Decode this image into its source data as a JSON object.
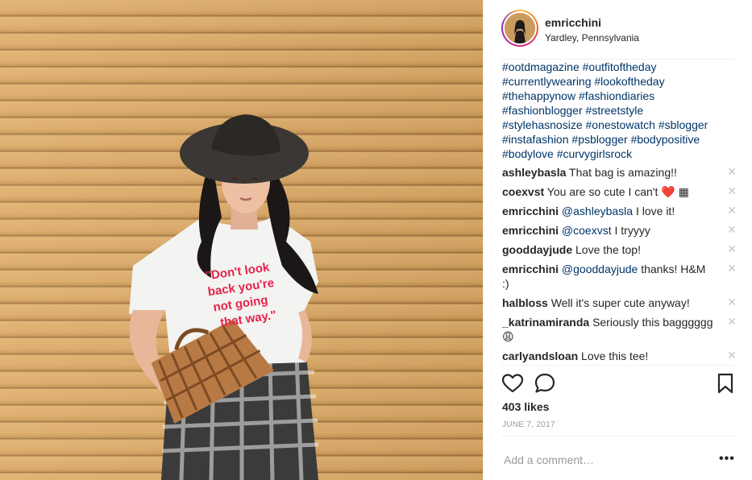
{
  "post": {
    "username": "emricchini",
    "location": "Yardley, Pennsylvania",
    "shirt_text": [
      "\"Don't look",
      "back you're",
      "not going",
      "that way.\""
    ]
  },
  "caption": {
    "lines": [
      [
        "#ootdmagazine",
        "#outfitoftheday"
      ],
      [
        "#currentlywearing",
        "#lookoftheday"
      ],
      [
        "#thehappynow",
        "#fashiondiaries"
      ],
      [
        "#fashionblogger",
        "#streetstyle"
      ],
      [
        "#stylehasnosize",
        "#onestowatch",
        "#sblogger"
      ],
      [
        "#instafashion",
        "#psblogger",
        "#bodypositive"
      ],
      [
        "#bodylove",
        "#curvygirlsrock"
      ]
    ]
  },
  "comments": [
    {
      "user": "ashleybasla",
      "mention": "",
      "text": "That bag is amazing!!"
    },
    {
      "user": "coexvst",
      "mention": "",
      "text": "You are so cute I can't ❤️",
      "suffix": "▦"
    },
    {
      "user": "emricchini",
      "mention": "@ashleybasla",
      "text": "I love it!"
    },
    {
      "user": "emricchini",
      "mention": "@coexvst",
      "text": "I tryyyy"
    },
    {
      "user": "gooddayjude",
      "mention": "",
      "text": "Love the top!"
    },
    {
      "user": "emricchini",
      "mention": "@gooddayjude",
      "text": "thanks! H&M :)"
    },
    {
      "user": "halbloss",
      "mention": "",
      "text": "Well it's super cute anyway!"
    },
    {
      "user": "_katrinamiranda",
      "mention": "",
      "text": "Seriously this bagggggg 😩"
    },
    {
      "user": "carlyandsloan",
      "mention": "",
      "text": "Love this tee!"
    }
  ],
  "stats": {
    "likes": "403 likes",
    "date": "JUNE 7, 2017"
  },
  "composer": {
    "placeholder": "Add a comment…",
    "more_label": "•••"
  },
  "icons": {
    "like": "heart-icon",
    "comment": "comment-bubble-icon",
    "save": "bookmark-icon",
    "delete": "close-icon"
  },
  "colors": {
    "link": "#003569",
    "text": "#262626",
    "muted": "#999999",
    "wall": "#dcab66"
  }
}
